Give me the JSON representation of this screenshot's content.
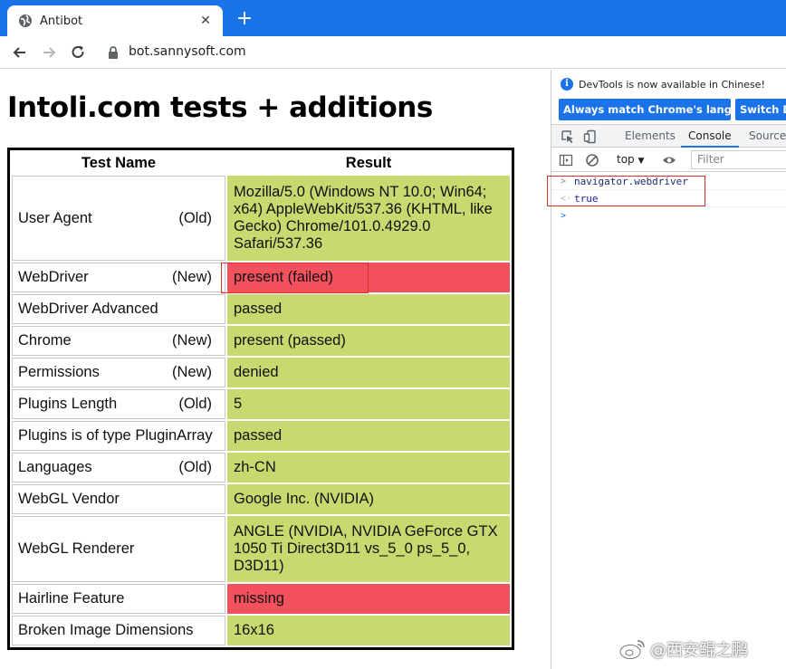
{
  "browser": {
    "tab_title": "Antibot",
    "url": "bot.sannysoft.com"
  },
  "page": {
    "title": "Intoli.com tests + additions",
    "headers": {
      "name": "Test Name",
      "result": "Result"
    },
    "rows": [
      {
        "name": "User Agent",
        "tag": "(Old)",
        "result": "Mozilla/5.0 (Windows NT 10.0; Win64; x64) AppleWebKit/537.36 (KHTML, like Gecko) Chrome/101.0.4929.0 Safari/537.36",
        "status": "passed"
      },
      {
        "name": "WebDriver",
        "tag": "(New)",
        "result": "present (failed)",
        "status": "failed"
      },
      {
        "name": "WebDriver Advanced",
        "tag": "",
        "result": "passed",
        "status": "passed"
      },
      {
        "name": "Chrome",
        "tag": "(New)",
        "result": "present (passed)",
        "status": "passed"
      },
      {
        "name": "Permissions",
        "tag": "(New)",
        "result": "denied",
        "status": "passed"
      },
      {
        "name": "Plugins Length",
        "tag": "(Old)",
        "result": "5",
        "status": "passed"
      },
      {
        "name": "Plugins is of type PluginArray",
        "tag": "",
        "result": "passed",
        "status": "passed"
      },
      {
        "name": "Languages",
        "tag": "(Old)",
        "result": "zh-CN",
        "status": "passed"
      },
      {
        "name": "WebGL Vendor",
        "tag": "",
        "result": "Google Inc. (NVIDIA)",
        "status": "passed"
      },
      {
        "name": "WebGL Renderer",
        "tag": "",
        "result": "ANGLE (NVIDIA, NVIDIA GeForce GTX 1050 Ti Direct3D11 vs_5_0 ps_5_0, D3D11)",
        "status": "passed"
      },
      {
        "name": "Hairline Feature",
        "tag": "",
        "result": "missing",
        "status": "failed"
      },
      {
        "name": "Broken Image Dimensions",
        "tag": "",
        "result": "16x16",
        "status": "passed"
      }
    ]
  },
  "devtools": {
    "info_text": "DevTools is now available in Chinese!",
    "match_language_button": "Always match Chrome's language",
    "switch_button": "Switch DevTools to Chinese",
    "tabs": {
      "elements": "Elements",
      "console": "Console",
      "sources": "Sources"
    },
    "context": "top",
    "filter_placeholder": "Filter",
    "console_lines": [
      {
        "type": "input",
        "text": "navigator.webdriver"
      },
      {
        "type": "output",
        "text": "true"
      }
    ]
  },
  "watermark": "@西安鲲之鹏",
  "colors": {
    "pass": "#c9d86f",
    "fail": "#f4515e",
    "accent": "#1a73e8"
  }
}
